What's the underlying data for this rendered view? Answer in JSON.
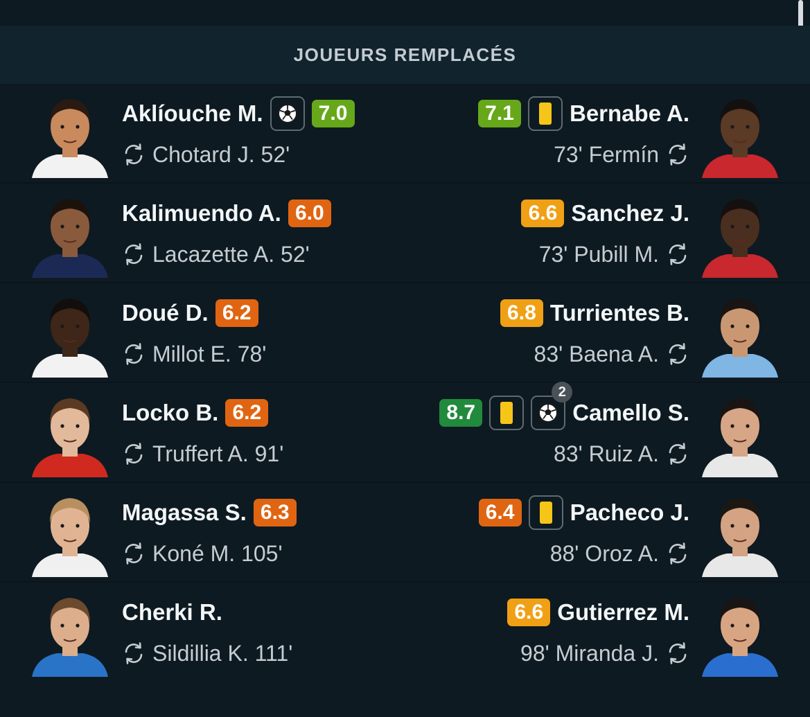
{
  "header": {
    "title": "JOUEURS REMPLACÉS"
  },
  "colors": {
    "background": "#0e1a22",
    "header_background": "#11232d",
    "rating_lime": "#66a81a",
    "rating_green": "#218a3c",
    "rating_orange": "#e06512",
    "rating_amber": "#f0a015",
    "yellow_card": "#f5c518"
  },
  "rows": [
    {
      "left": {
        "name": "Aklíouche M.",
        "rating": "7.0",
        "rating_color": "lime",
        "events": [
          "goal-icon"
        ],
        "sub": "Chotard J. 52'"
      },
      "right": {
        "name": "Bernabe A.",
        "rating": "7.1",
        "rating_color": "lime",
        "events": [
          "yellow-card-icon"
        ],
        "sub": "73' Fermín"
      }
    },
    {
      "left": {
        "name": "Kalimuendo A.",
        "rating": "6.0",
        "rating_color": "orange",
        "events": [],
        "sub": "Lacazette A. 52'"
      },
      "right": {
        "name": "Sanchez J.",
        "rating": "6.6",
        "rating_color": "amber",
        "events": [],
        "sub": "73' Pubill M."
      }
    },
    {
      "left": {
        "name": "Doué D.",
        "rating": "6.2",
        "rating_color": "orange",
        "events": [],
        "sub": "Millot E. 78'"
      },
      "right": {
        "name": "Turrientes B.",
        "rating": "6.8",
        "rating_color": "amber",
        "events": [],
        "sub": "83' Baena A."
      }
    },
    {
      "left": {
        "name": "Locko B.",
        "rating": "6.2",
        "rating_color": "orange",
        "events": [],
        "sub": "Truffert A. 91'"
      },
      "right": {
        "name": "Camello S.",
        "rating": "8.7",
        "rating_color": "green",
        "events": [
          "yellow-card-icon",
          "goal-icon"
        ],
        "goal_count": "2",
        "sub": "83' Ruiz A."
      }
    },
    {
      "left": {
        "name": "Magassa S.",
        "rating": "6.3",
        "rating_color": "orange",
        "events": [],
        "sub": "Koné M. 105'"
      },
      "right": {
        "name": "Pacheco J.",
        "rating": "6.4",
        "rating_color": "orange",
        "events": [
          "yellow-card-icon"
        ],
        "sub": "88' Oroz A."
      }
    },
    {
      "left": {
        "name": "Cherki R.",
        "rating": "",
        "rating_color": "",
        "events": [],
        "sub": "Sildillia K. 111'"
      },
      "right": {
        "name": "Gutierrez M.",
        "rating": "6.6",
        "rating_color": "amber",
        "events": [],
        "sub": "98' Miranda J."
      }
    }
  ]
}
